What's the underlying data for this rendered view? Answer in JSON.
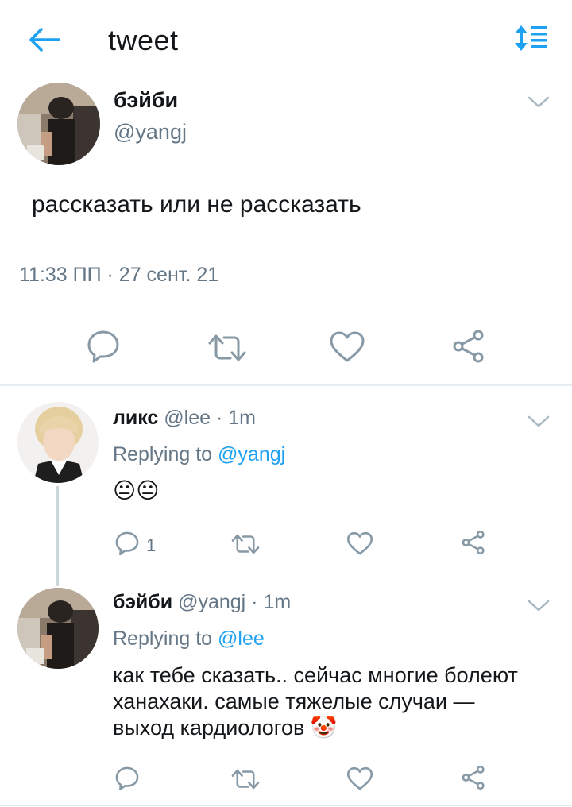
{
  "header": {
    "title": "tweet"
  },
  "main_tweet": {
    "author_name": "бэйби",
    "author_handle": "@yangj",
    "text": "рассказать или не рассказать",
    "timestamp": "11:33 ПП · 27 сент. 21"
  },
  "replies": [
    {
      "author_name": "ликс",
      "author_handle": "@lee",
      "time": "· 1m",
      "replying_prefix": "Replying to",
      "replying_to": "@yangj",
      "text": "😐😐",
      "reply_count": "1"
    },
    {
      "author_name": "бэйби",
      "author_handle": "@yangj",
      "time": "· 1m",
      "replying_prefix": "Replying to",
      "replying_to": "@lee",
      "text_line1": "как тебе сказать.. сейчас многие болеют",
      "text_line2": "ханахаки. самые тяжелые случаи —",
      "text_line3": "выход кардиологов 🤡"
    }
  ],
  "colors": {
    "accent": "#1da1f2",
    "muted": "#657786",
    "icon": "#8899a6"
  }
}
